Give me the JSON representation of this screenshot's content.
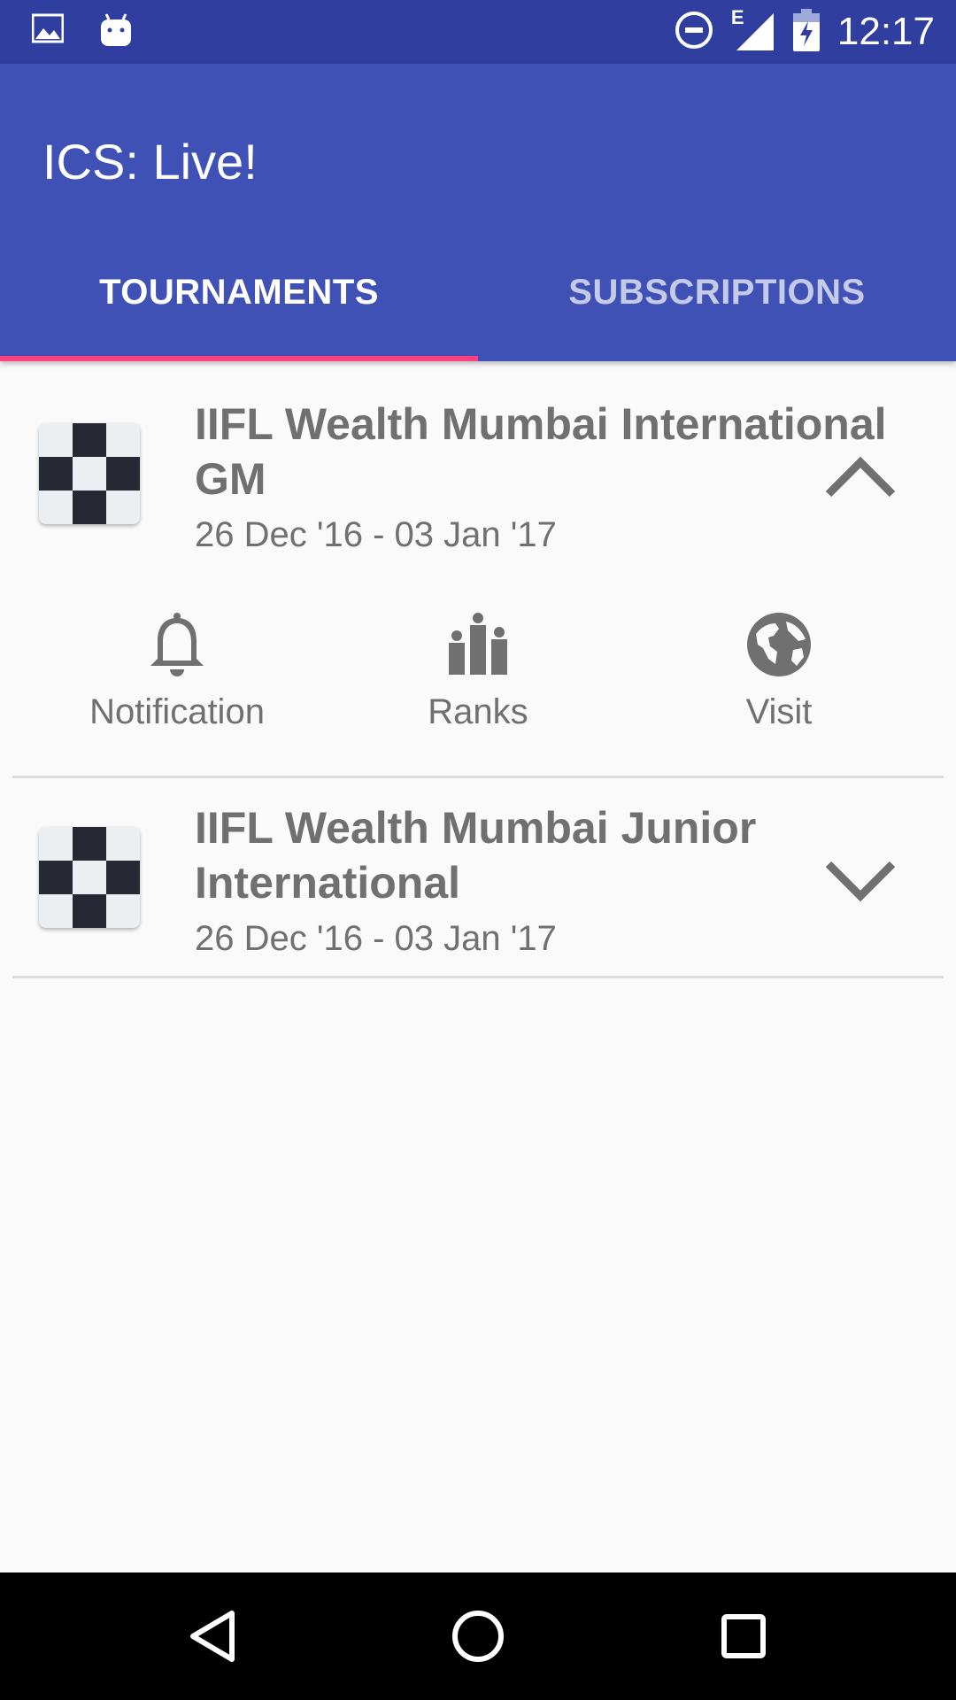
{
  "status_bar": {
    "time": "12:17",
    "network_label": "E",
    "icons": [
      "image-icon",
      "android-icon",
      "do-not-disturb-icon",
      "signal-icon",
      "battery-charging-icon"
    ]
  },
  "app_bar": {
    "title": "ICS: Live!"
  },
  "tabs": [
    {
      "label": "TOURNAMENTS",
      "active": true
    },
    {
      "label": "SUBSCRIPTIONS",
      "active": false
    }
  ],
  "colors": {
    "status_bar": "#303f9f",
    "primary": "#3f51b5",
    "accent": "#ff4081",
    "inactive_tab_text": "#c5cae9",
    "item_text": "#707070"
  },
  "tournaments": [
    {
      "title": "IIFL Wealth Mumbai International GM",
      "dates": "26 Dec '16 - 03 Jan '17",
      "expanded": true,
      "actions": [
        {
          "label": "Notification",
          "icon": "bell-icon"
        },
        {
          "label": "Ranks",
          "icon": "ranks-icon"
        },
        {
          "label": "Visit",
          "icon": "globe-icon"
        }
      ]
    },
    {
      "title": "IIFL Wealth Mumbai Junior International",
      "dates": "26 Dec '16 - 03 Jan '17",
      "expanded": false
    }
  ],
  "nav_bar": {
    "buttons": [
      "back-icon",
      "home-icon",
      "recents-icon"
    ]
  }
}
